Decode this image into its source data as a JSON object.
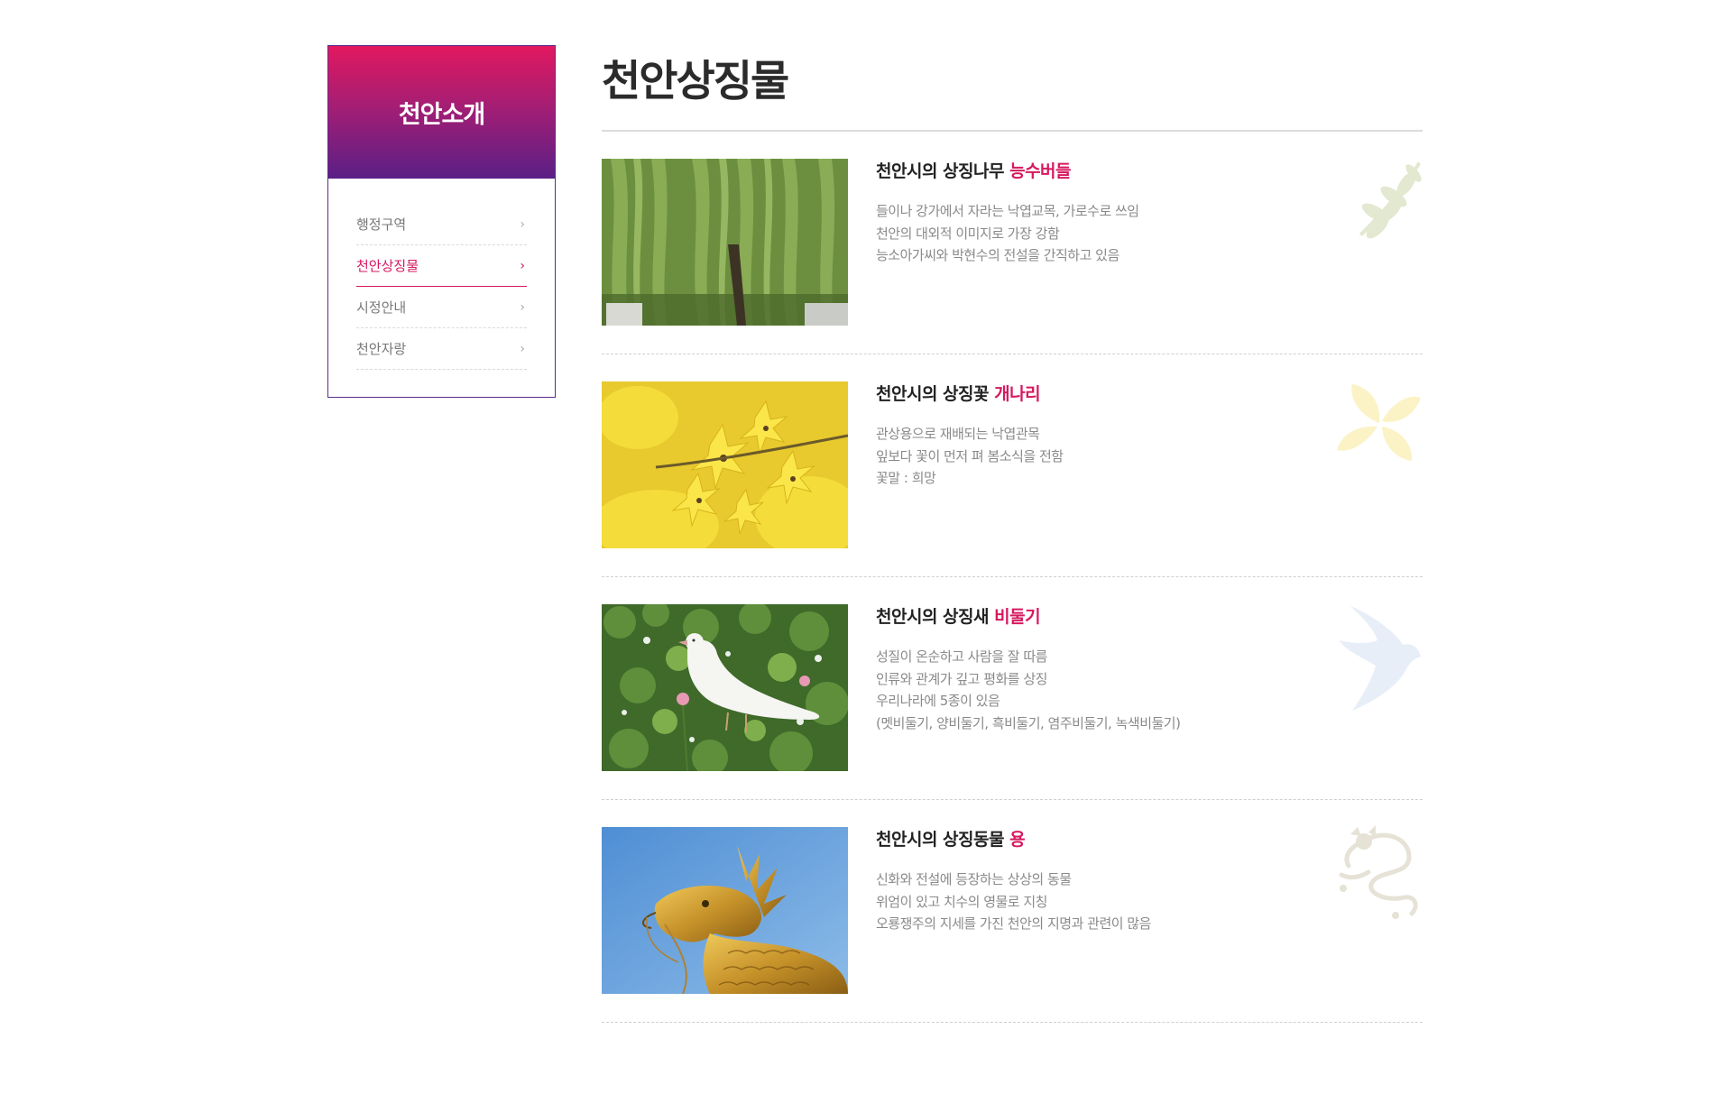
{
  "sidebar": {
    "title": "천안소개",
    "items": [
      {
        "label": "행정구역",
        "active": false
      },
      {
        "label": "천안상징물",
        "active": true
      },
      {
        "label": "시정안내",
        "active": false
      },
      {
        "label": "천안자랑",
        "active": false
      }
    ]
  },
  "main": {
    "title": "천안상징물",
    "symbols": [
      {
        "heading_prefix": "천안시의 상징나무",
        "heading_name": "능수버들",
        "lines": [
          "들이나 강가에서 자라는 낙엽교목, 가로수로 쓰임",
          "천안의 대외적 이미지로 가장 강함",
          "능소아가씨와 박현수의 전설을 간직하고 있음"
        ],
        "photo": "willow-tree-photo",
        "deco_icon": "leaf-branch-icon"
      },
      {
        "heading_prefix": "천안시의 상징꽃",
        "heading_name": "개나리",
        "lines": [
          "관상용으로 재배되는 낙엽관목",
          "잎보다 꽃이 먼저 펴 봄소식을 전함",
          "꽃말 : 희망"
        ],
        "photo": "forsythia-photo",
        "deco_icon": "flower-icon"
      },
      {
        "heading_prefix": "천안시의 상징새",
        "heading_name": "비둘기",
        "lines": [
          "성질이 온순하고 사람을 잘 따름",
          "인류와 관계가 깊고 평화를 상징",
          "우리나라에 5종이 있음",
          "(멧비둘기, 양비둘기, 흑비둘기, 염주비둘기, 녹색비둘기)"
        ],
        "photo": "white-dove-photo",
        "deco_icon": "bird-icon"
      },
      {
        "heading_prefix": "천안시의 상징동물",
        "heading_name": "용",
        "lines": [
          "신화와 전설에 등장하는 상상의 동물",
          "위엄이 있고 치수의 영물로 지칭",
          "오룡쟁주의 지세를 가진 천안의 지명과 관련이 많음"
        ],
        "photo": "golden-dragon-photo",
        "deco_icon": "dragon-icon"
      }
    ]
  },
  "colors": {
    "accent": "#d6195f",
    "sidebar_gradient_top": "#e2185f",
    "sidebar_gradient_bottom": "#5a1f86",
    "border": "#5a2d8c"
  }
}
